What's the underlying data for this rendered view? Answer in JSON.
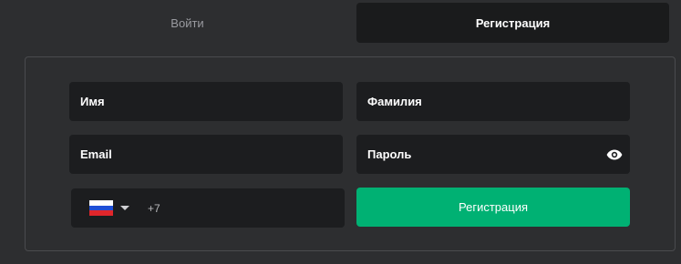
{
  "tabs": {
    "login_label": "Войти",
    "register_label": "Регистрация",
    "active": "register"
  },
  "form": {
    "first_name_placeholder": "Имя",
    "last_name_placeholder": "Фамилия",
    "email_placeholder": "Email",
    "password_placeholder": "Пароль",
    "password_toggle_icon": "eye-icon",
    "phone": {
      "country_flag_icon": "russia-flag-icon",
      "dropdown_icon": "caret-down-icon",
      "prefix": "+7",
      "value": ""
    },
    "submit_label": "Регистрация"
  },
  "colors": {
    "background": "#2d2e30",
    "field_background": "#1c1d1f",
    "active_tab_background": "#1a1b1c",
    "accent": "#00b173"
  }
}
